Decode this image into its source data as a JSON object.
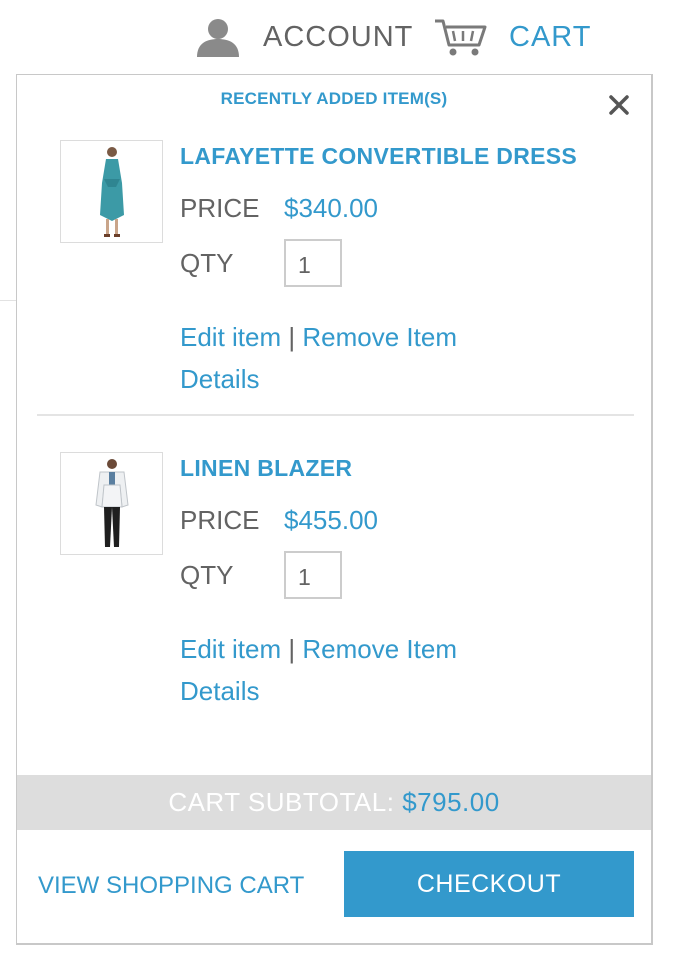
{
  "header": {
    "account_label": "ACCOUNT",
    "account_icon": "user-icon",
    "cart_label": "CART",
    "cart_icon": "shopping-cart-icon"
  },
  "minicart": {
    "title": "RECENTLY ADDED ITEM(S)",
    "close_icon": "close-icon",
    "items": [
      {
        "name": "LAFAYETTE CONVERTIBLE DRESS",
        "price_label": "PRICE",
        "price": "$340.00",
        "qty_label": "QTY",
        "qty": "1",
        "edit_label": "Edit item",
        "separator": "|",
        "remove_label": "Remove Item",
        "details_label": "Details"
      },
      {
        "name": "LINEN BLAZER",
        "price_label": "PRICE",
        "price": "$455.00",
        "qty_label": "QTY",
        "qty": "1",
        "edit_label": "Edit item",
        "separator": "|",
        "remove_label": "Remove Item",
        "details_label": "Details"
      }
    ],
    "subtotal_label": "CART SUBTOTAL:",
    "subtotal_value": "$795.00",
    "view_cart_label": "VIEW SHOPPING CART",
    "checkout_label": "CHECKOUT"
  },
  "colors": {
    "accent": "#3399cc",
    "text": "#636363",
    "subtotal_bg": "#dddddd"
  }
}
